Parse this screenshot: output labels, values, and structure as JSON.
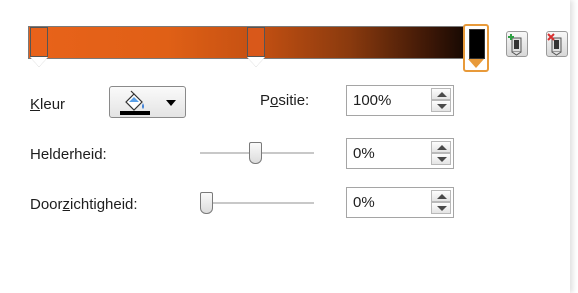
{
  "gradient": {
    "stops": [
      {
        "name": "stop-1",
        "color": "#e8621a",
        "position": 0
      },
      {
        "name": "stop-2",
        "color": "#d9581a",
        "position": 50
      },
      {
        "name": "stop-3",
        "color": "#000000",
        "position": 100,
        "selected": true
      }
    ]
  },
  "actions": {
    "add_stop_icon": "add-stop-icon",
    "remove_stop_icon": "remove-stop-icon"
  },
  "color": {
    "label_prefix": "",
    "label_hotkey": "K",
    "label_rest": "leur",
    "button_icon": "paint-bucket-icon"
  },
  "position": {
    "label_pre": "P",
    "label_hotkey": "o",
    "label_rest": "sitie:",
    "value": "100%"
  },
  "brightness": {
    "label": "Helderheid:",
    "value": "0%",
    "level": 0
  },
  "transparency": {
    "label_pre": "Door",
    "label_hotkey": "z",
    "label_rest": "ichtigheid:",
    "value": "0%",
    "level": 0
  }
}
